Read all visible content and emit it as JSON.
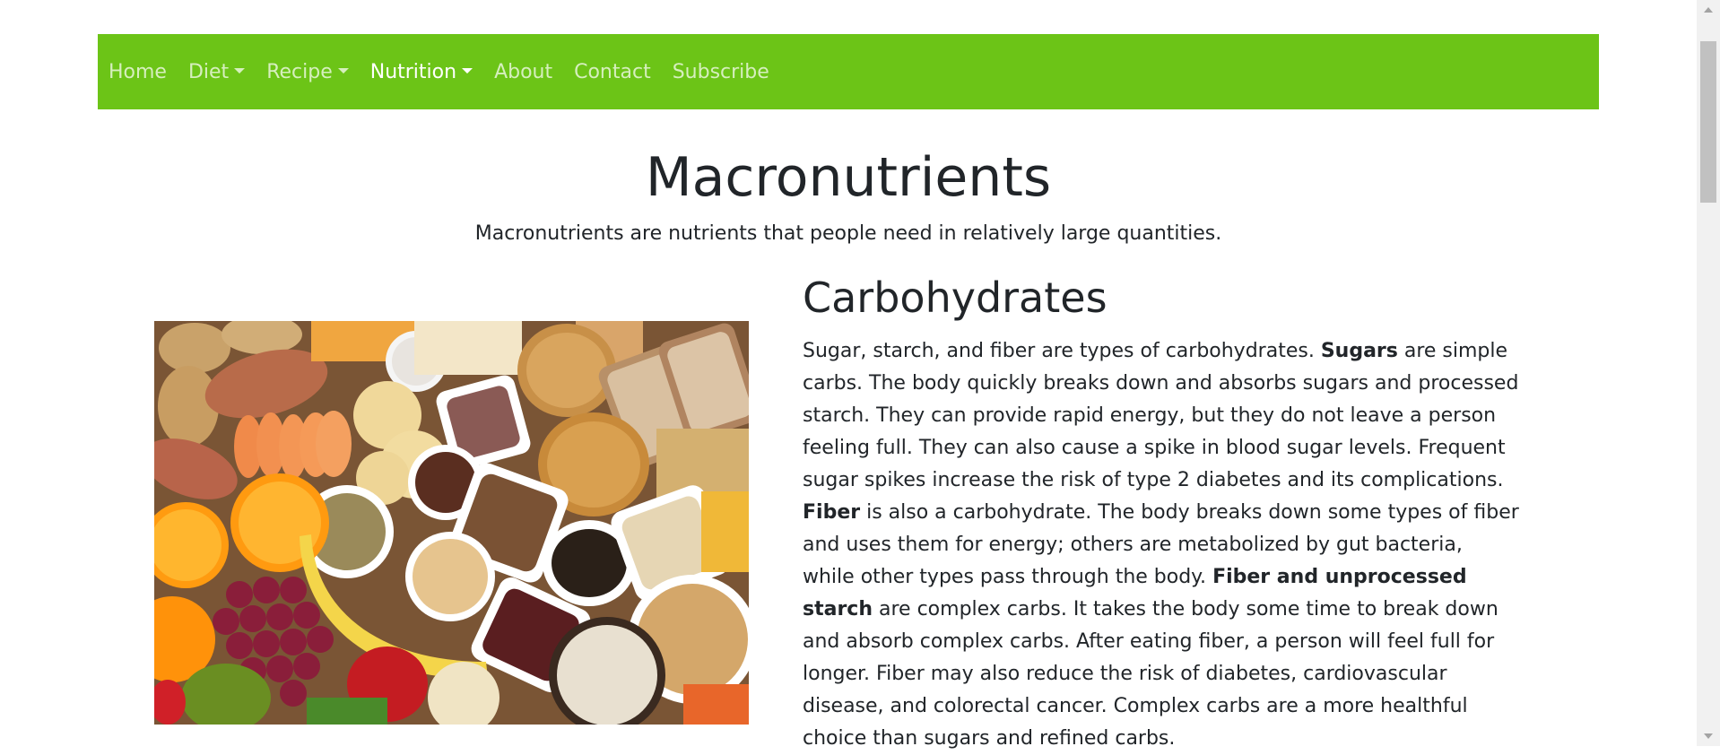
{
  "nav": {
    "items": [
      {
        "label": "Home",
        "dropdown": false,
        "active": false
      },
      {
        "label": "Diet",
        "dropdown": true,
        "active": false
      },
      {
        "label": "Recipe",
        "dropdown": true,
        "active": false
      },
      {
        "label": "Nutrition",
        "dropdown": true,
        "active": true
      },
      {
        "label": "About",
        "dropdown": false,
        "active": false
      },
      {
        "label": "Contact",
        "dropdown": false,
        "active": false
      },
      {
        "label": "Subscribe",
        "dropdown": false,
        "active": false
      }
    ],
    "background": "#6cc417"
  },
  "page": {
    "title": "Macronutrients",
    "lead": "Macronutrients are nutrients that people need in relatively large quantities."
  },
  "carbs": {
    "heading": "Carbohydrates",
    "p1": "Sugar, starch, and fiber are types of carbohydrates. ",
    "b1": "Sugars",
    "p2": " are simple carbs. The body quickly breaks down and absorbs sugars and processed starch. They can provide rapid energy, but they do not leave a person feeling full. They can also cause a spike in blood sugar levels. Frequent sugar spikes increase the risk of type 2 diabetes and its complications. ",
    "b2": "Fiber",
    "p3": " is also a carbohydrate. The body breaks down some types of fiber and uses them for energy; others are metabolized by gut bacteria, while other types pass through the body. ",
    "b3": "Fiber and unprocessed starch",
    "p4": " are complex carbs. It takes the body some time to break down and absorb complex carbs. After eating fiber, a person will feel full for longer. Fiber may also reduce the risk of diabetes, cardiovascular disease, and colorectal cancer. Complex carbs are a more healthful choice than sugars and refined carbs."
  }
}
